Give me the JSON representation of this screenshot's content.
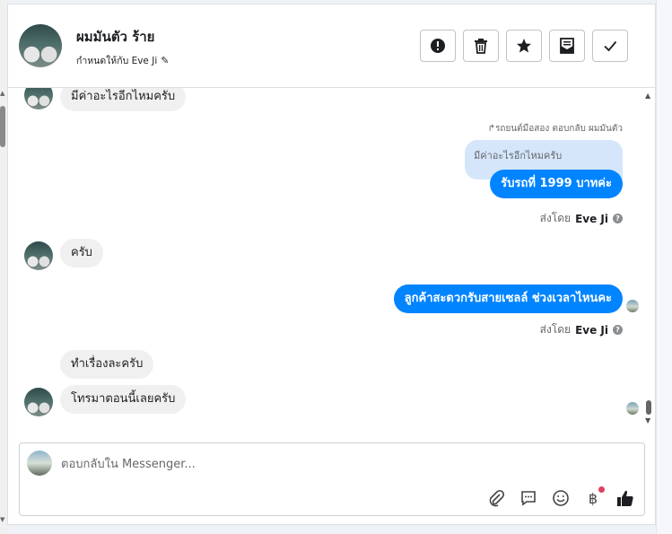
{
  "header": {
    "contact_name": "ผมมันตัว ร้าย",
    "assigned_text": "กำหนดให้กับ Eve Ji",
    "actions": [
      {
        "icon": "alert-icon",
        "label": "spam"
      },
      {
        "icon": "trash-icon",
        "label": "delete"
      },
      {
        "icon": "star-icon",
        "label": "follow up"
      },
      {
        "icon": "mark-unread-icon",
        "label": "mark unread"
      },
      {
        "icon": "check-icon",
        "label": "done"
      }
    ]
  },
  "messages": {
    "m1": "มีค่าอะไรอีกไหมครับ",
    "reply_label": "รถยนต์มือสอง ตอบกลับ ผมมันตัว",
    "quoted": "มีค่าอะไรอีกไหมครับ",
    "m2": "รับรถที่ 1999 บาทค่ะ",
    "sent_by_prefix": "ส่งโดย",
    "sent_by_name": "Eve Ji",
    "m3": "ครับ",
    "m4": "ลูกค้าสะดวกรับสายเซลล์ ช่วงเวลาไหนคะ",
    "m5": "ทำเรื่องละครับ",
    "m6": "โทรมาตอนนี้เลยครับ"
  },
  "composer": {
    "placeholder": "ตอบกลับใน Messenger...",
    "tools": [
      "attachment-icon",
      "saved-reply-icon",
      "emoji-icon",
      "payment-icon",
      "like-icon"
    ],
    "payment_symbol": "฿"
  },
  "colors": {
    "accent": "#0084ff",
    "incoming_bubble": "#f0f0f0",
    "quoted_bubble": "#d5e6fb",
    "notification_dot": "#e0405f"
  }
}
